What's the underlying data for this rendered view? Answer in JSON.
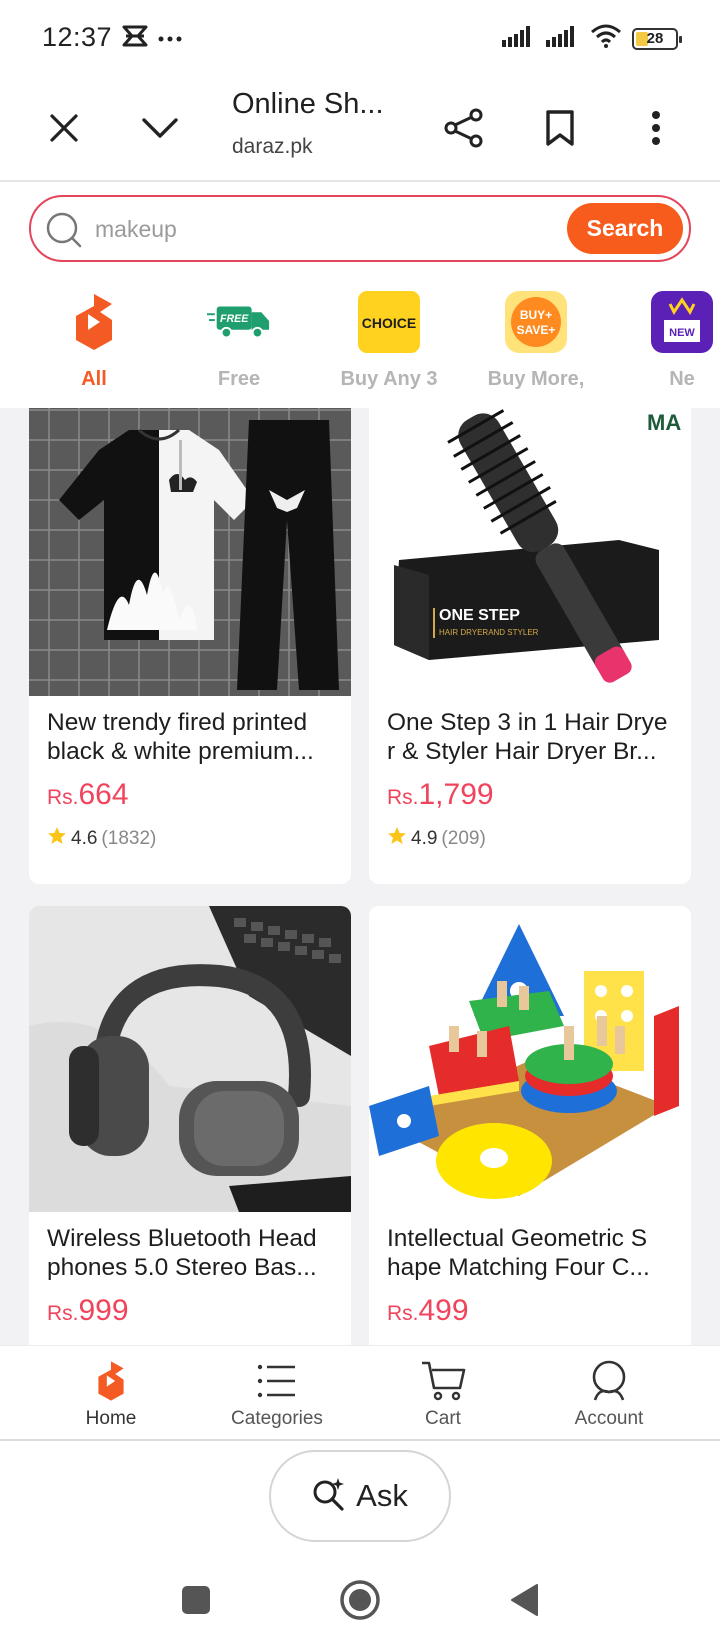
{
  "status_bar": {
    "time": "12:37",
    "battery_level": "28",
    "icons": [
      "mirror-icon",
      "more-dots-icon",
      "signal-icon",
      "signal-icon",
      "wifi-icon",
      "battery-icon"
    ]
  },
  "browser": {
    "page_title": "Online Sh...",
    "url": "daraz.pk",
    "icons": [
      "close-icon",
      "chevron-down-icon",
      "share-icon",
      "bookmark-icon",
      "more-vertical-icon"
    ]
  },
  "search": {
    "placeholder": "makeup",
    "button_label": "Search"
  },
  "categories": [
    {
      "label": "All",
      "icon": "daraz-logo-icon",
      "active": true
    },
    {
      "label": "Free",
      "icon": "free-delivery-truck-icon",
      "active": false
    },
    {
      "label": "Buy Any 3",
      "icon": "choice-badge-icon",
      "active": false
    },
    {
      "label": "Buy More,",
      "icon": "buy-more-save-more-icon",
      "active": false
    },
    {
      "label": "Ne",
      "icon": "new-arrivals-icon",
      "active": false
    }
  ],
  "products": [
    {
      "title": "New trendy fired printed black & white premium...",
      "currency": "Rs.",
      "price": "664",
      "rating": "4.6",
      "reviews": "(1832)",
      "image": "tshirt-trouser-set-image"
    },
    {
      "title": "One Step 3 in 1 Hair Drye r & Styler Hair Dryer Br...",
      "currency": "Rs.",
      "price": "1,799",
      "rating": "4.9",
      "reviews": "(209)",
      "image": "hair-dryer-brush-image",
      "box_text": "ONE STEP",
      "box_subtext": "HAIR DRYERAND STYLER",
      "brand_mark": "MA"
    },
    {
      "title": "Wireless Bluetooth Head phones 5.0 Stereo Bas...",
      "currency": "Rs.",
      "price": "999",
      "image": "headphones-image"
    },
    {
      "title": "Intellectual Geometric S hape Matching Four C...",
      "currency": "Rs.",
      "price": "499",
      "image": "geometric-toy-image"
    }
  ],
  "app_nav": [
    {
      "label": "Home",
      "icon": "home-logo-icon",
      "active": true
    },
    {
      "label": "Categories",
      "icon": "list-icon",
      "active": false
    },
    {
      "label": "Cart",
      "icon": "cart-icon",
      "active": false
    },
    {
      "label": "Account",
      "icon": "account-icon",
      "active": false
    }
  ],
  "ask": {
    "label": "Ask",
    "icon": "ai-search-sparkle-icon"
  },
  "system_nav": [
    "recent-apps-icon",
    "home-button-icon",
    "back-icon"
  ],
  "colors": {
    "accent": "#f75c1c",
    "price": "#f0445c",
    "search_border": "#e3465a"
  }
}
